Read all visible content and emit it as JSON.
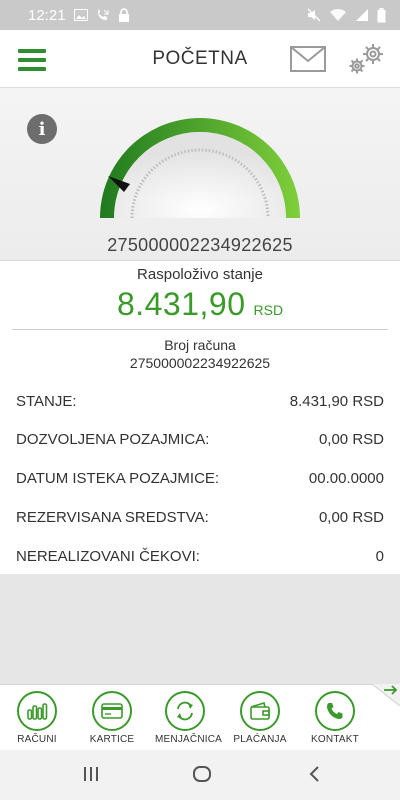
{
  "status_bar": {
    "time": "12:21"
  },
  "header": {
    "title": "POČETNA"
  },
  "gauge": {
    "account_number": "275000002234922625"
  },
  "balance": {
    "available_label": "Raspoloživo stanje",
    "available_amount": "8.431,90",
    "available_currency": "RSD",
    "account_label": "Broj računa",
    "account_number": "275000002234922625"
  },
  "details": [
    {
      "label": "STANJE:",
      "value": "8.431,90 RSD"
    },
    {
      "label": "DOZVOLJENA POZAJMICA:",
      "value": "0,00 RSD"
    },
    {
      "label": "DATUM ISTEKA POZAJMICE:",
      "value": "00.00.0000"
    },
    {
      "label": "REZERVISANA SREDSTVA:",
      "value": "0,00 RSD"
    },
    {
      "label": "NEREALIZOVANI ČEKOVI:",
      "value": "0"
    }
  ],
  "bottom_nav": [
    {
      "label": "RAČUNI",
      "icon": "bar-chart-icon"
    },
    {
      "label": "KARTICE",
      "icon": "card-icon"
    },
    {
      "label": "MENJAČNICA",
      "icon": "exchange-icon"
    },
    {
      "label": "PLAĆANJA",
      "icon": "wallet-icon"
    },
    {
      "label": "KONTAKT",
      "icon": "phone-icon"
    }
  ],
  "colors": {
    "accent": "#3a9a2a",
    "status_bar": "#c9c9c9"
  }
}
